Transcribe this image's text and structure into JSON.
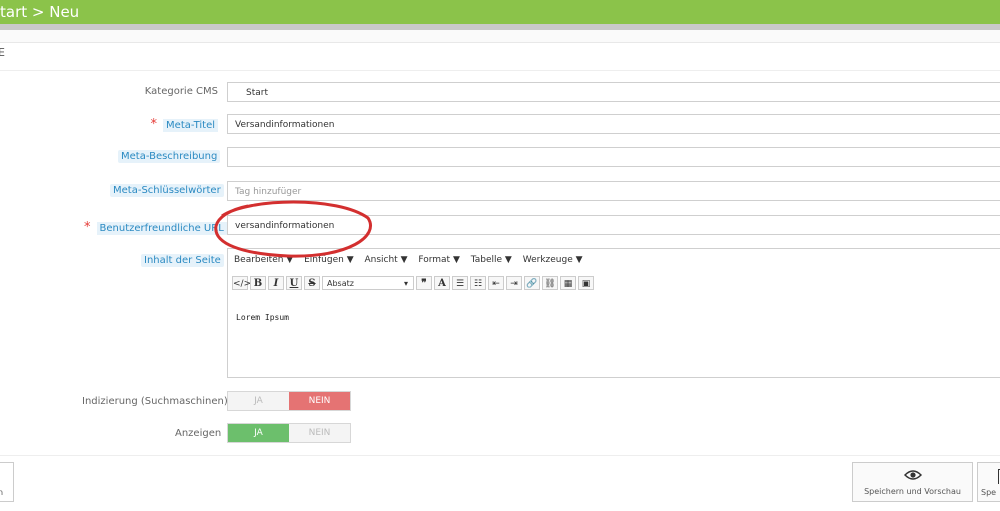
{
  "header": {
    "breadcrumb": "tart > Neu",
    "section_label": "E"
  },
  "form": {
    "kategorie": {
      "label": "Kategorie CMS",
      "value": "Start"
    },
    "meta_titel": {
      "label": "Meta-Titel",
      "required_mark": "*",
      "value": "Versandinformationen"
    },
    "meta_beschreibung": {
      "label": "Meta-Beschreibung",
      "value": ""
    },
    "meta_keywords": {
      "label": "Meta-Schlüsselwörter",
      "placeholder": "Tag hinzufüger"
    },
    "friendly_url": {
      "label": "Benutzerfreundliche URL",
      "required_mark": "*",
      "value": "versandinformationen"
    },
    "content": {
      "label": "Inhalt der Seite",
      "menu": [
        "Bearbeiten ▼",
        "Einfügen ▼",
        "Ansicht ▼",
        "Format ▼",
        "Tabelle ▼",
        "Werkzeuge ▼"
      ],
      "toolbar": {
        "code": "</>",
        "bold": "B",
        "italic": "I",
        "underline": "U",
        "strike": "S",
        "format_select": "Absatz",
        "quote": "❞",
        "color": "A",
        "ul": "☰",
        "ol": "☷",
        "outdent": "⇤",
        "indent": "⇥",
        "link": "🔗",
        "unlink": "⛓",
        "media": "▦",
        "image": "▣"
      },
      "body": "Lorem Ipsum"
    },
    "indexing": {
      "label": "Indizierung (Suchmaschinen)",
      "yes": "JA",
      "no": "NEIN",
      "selected": "no"
    },
    "display": {
      "label": "Anzeigen",
      "yes": "JA",
      "no": "NEIN",
      "selected": "yes"
    }
  },
  "footer": {
    "left_button_text": "n",
    "preview_button": {
      "label": "Speichern und Vorschau",
      "icon": "eye-icon"
    },
    "save_button": {
      "label": "Spe",
      "icon": "save-icon"
    }
  },
  "colors": {
    "topbar": "#8bc34a",
    "nein_active": "#e57373",
    "ja_active": "#6cbf6c",
    "annotation": "#d32f2f"
  }
}
